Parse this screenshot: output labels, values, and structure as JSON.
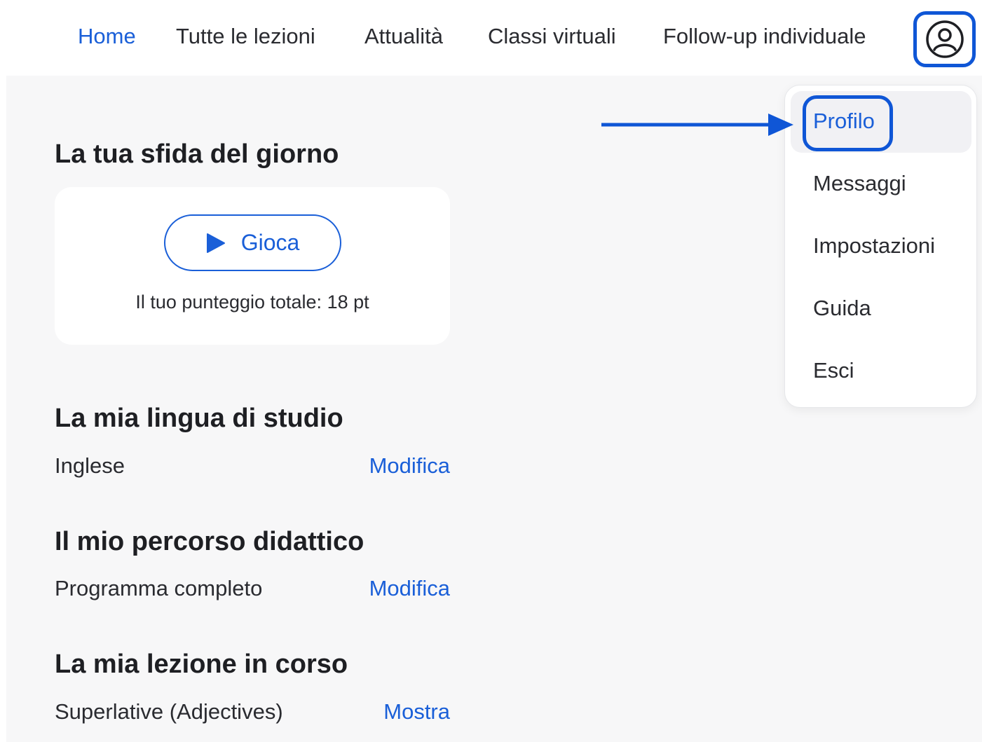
{
  "nav": {
    "items": [
      {
        "label": "Home",
        "active": true
      },
      {
        "label": "Tutte le lezioni"
      },
      {
        "label": "Attualità"
      },
      {
        "label": "Classi virtuali"
      },
      {
        "label": "Follow-up individuale"
      }
    ],
    "account_icon": "user-circle-icon"
  },
  "challenge": {
    "title": "La tua sfida del giorno",
    "play_label": "Gioca",
    "play_icon": "play-icon",
    "score_text": "Il tuo punteggio totale: 18 pt"
  },
  "language": {
    "title": "La mia lingua di studio",
    "value": "Inglese",
    "action": "Modifica"
  },
  "path": {
    "title": "Il mio percorso didattico",
    "value": "Programma completo",
    "action": "Modifica"
  },
  "lesson": {
    "title": "La mia lezione in corso",
    "value": "Superlative (Adjectives)",
    "action": "Mostra"
  },
  "menu": {
    "items": [
      {
        "label": "Profilo",
        "selected": true
      },
      {
        "label": "Messaggi"
      },
      {
        "label": "Impostazioni"
      },
      {
        "label": "Guida"
      },
      {
        "label": "Esci"
      }
    ]
  },
  "colors": {
    "accent": "#1a5fd8",
    "highlight_ring": "#0f56d6",
    "background": "#f7f7f8"
  }
}
